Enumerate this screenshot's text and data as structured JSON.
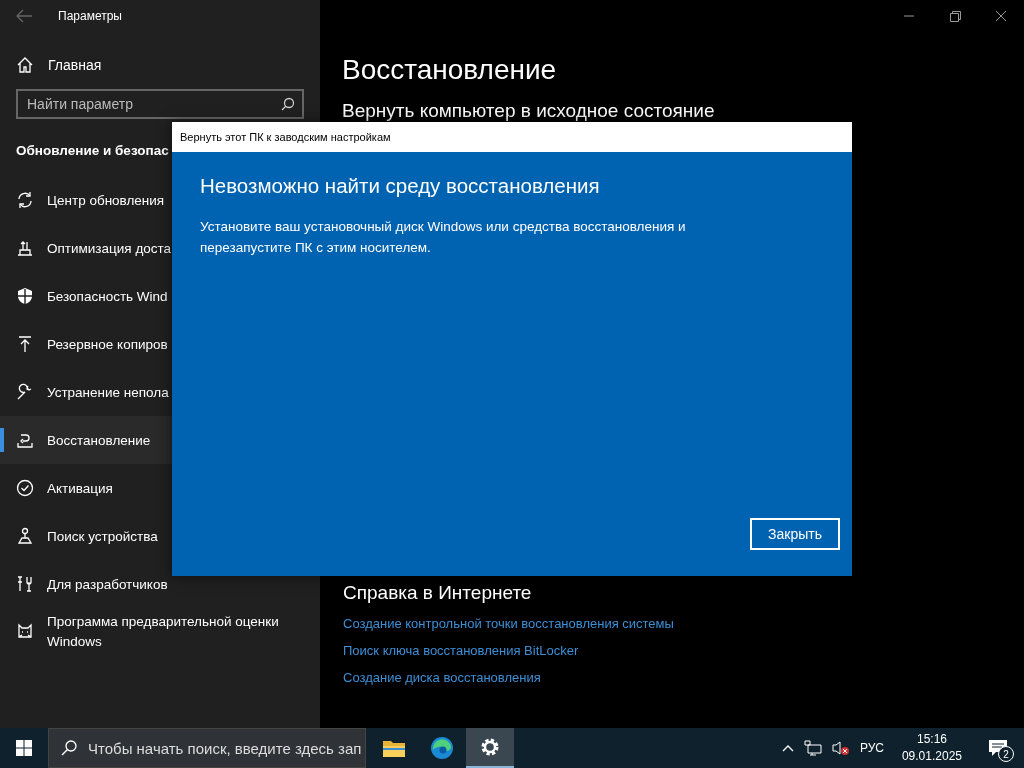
{
  "window": {
    "title": "Параметры"
  },
  "sidebar": {
    "home": "Главная",
    "search": {
      "placeholder": "Найти параметр"
    },
    "section": "Обновление и безопас",
    "items": [
      {
        "label": "Центр обновления",
        "selected": false
      },
      {
        "label": "Оптимизация доста",
        "selected": false
      },
      {
        "label": "Безопасность Wind",
        "selected": false
      },
      {
        "label": "Резервное копиров",
        "selected": false
      },
      {
        "label": "Устранение непола",
        "selected": false
      },
      {
        "label": "Восстановление",
        "selected": true
      },
      {
        "label": "Активация",
        "selected": false
      },
      {
        "label": "Поиск устройства",
        "selected": false
      },
      {
        "label": "Для разработчиков",
        "selected": false
      },
      {
        "label": "Программа предварительной оценки Windows",
        "selected": false
      }
    ]
  },
  "main": {
    "title": "Восстановление",
    "section_heading": "Вернуть компьютер в исходное состояние",
    "help": {
      "title": "Справка в Интернете",
      "links": [
        "Создание контрольной точки восстановления системы",
        "Поиск ключа восстановления BitLocker",
        "Создание диска восстановления"
      ]
    }
  },
  "dialog": {
    "title": "Вернуть этот ПК к заводским настройкам",
    "heading": "Невозможно найти среду восстановления",
    "message": "Установите ваш установочный диск Windows или средства восстановления и перезапустите ПК с этим носителем.",
    "button": "Закрыть"
  },
  "taskbar": {
    "search": {
      "placeholder": "Чтобы начать поиск, введите здесь зап"
    },
    "apps": [
      {
        "selected": false
      },
      {
        "selected": false
      },
      {
        "selected": true
      }
    ],
    "tray": {
      "language": "РУС",
      "time": "15:16",
      "date": "09.01.2025",
      "notifications": "2"
    }
  }
}
